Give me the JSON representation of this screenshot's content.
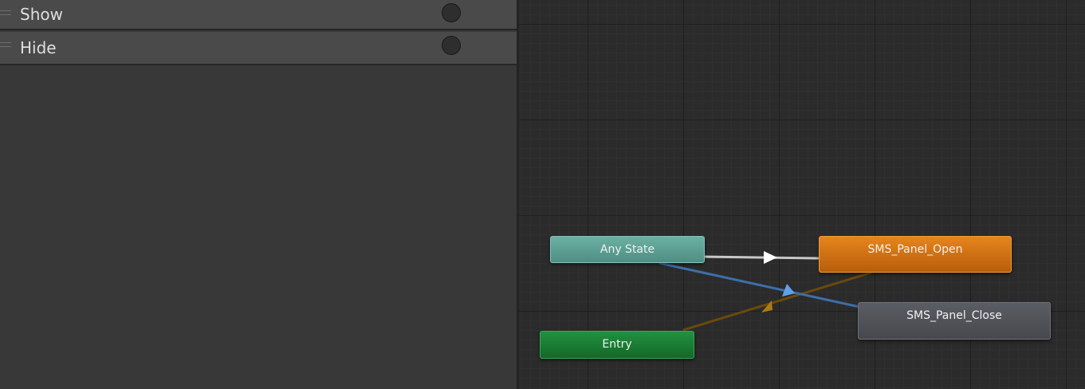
{
  "parameters": [
    {
      "name": "Show",
      "type": "trigger"
    },
    {
      "name": "Hide",
      "type": "trigger"
    }
  ],
  "graph": {
    "states": {
      "any_state": {
        "label": "Any State",
        "color": "#5a9e94"
      },
      "entry": {
        "label": "Entry",
        "color": "#1a7a34"
      },
      "open": {
        "label": "SMS_Panel_Open",
        "color": "#d2741a"
      },
      "close": {
        "label": "SMS_Panel_Close",
        "color": "#505257"
      }
    },
    "transitions": [
      {
        "from": "Any State",
        "to": "SMS_Panel_Open",
        "color": "#c8c8c8"
      },
      {
        "from": "Any State",
        "to": "SMS_Panel_Close",
        "color": "#3d6fa8"
      },
      {
        "from": "Entry",
        "to": "SMS_Panel_Open",
        "color": "#6b4a0c"
      }
    ]
  }
}
